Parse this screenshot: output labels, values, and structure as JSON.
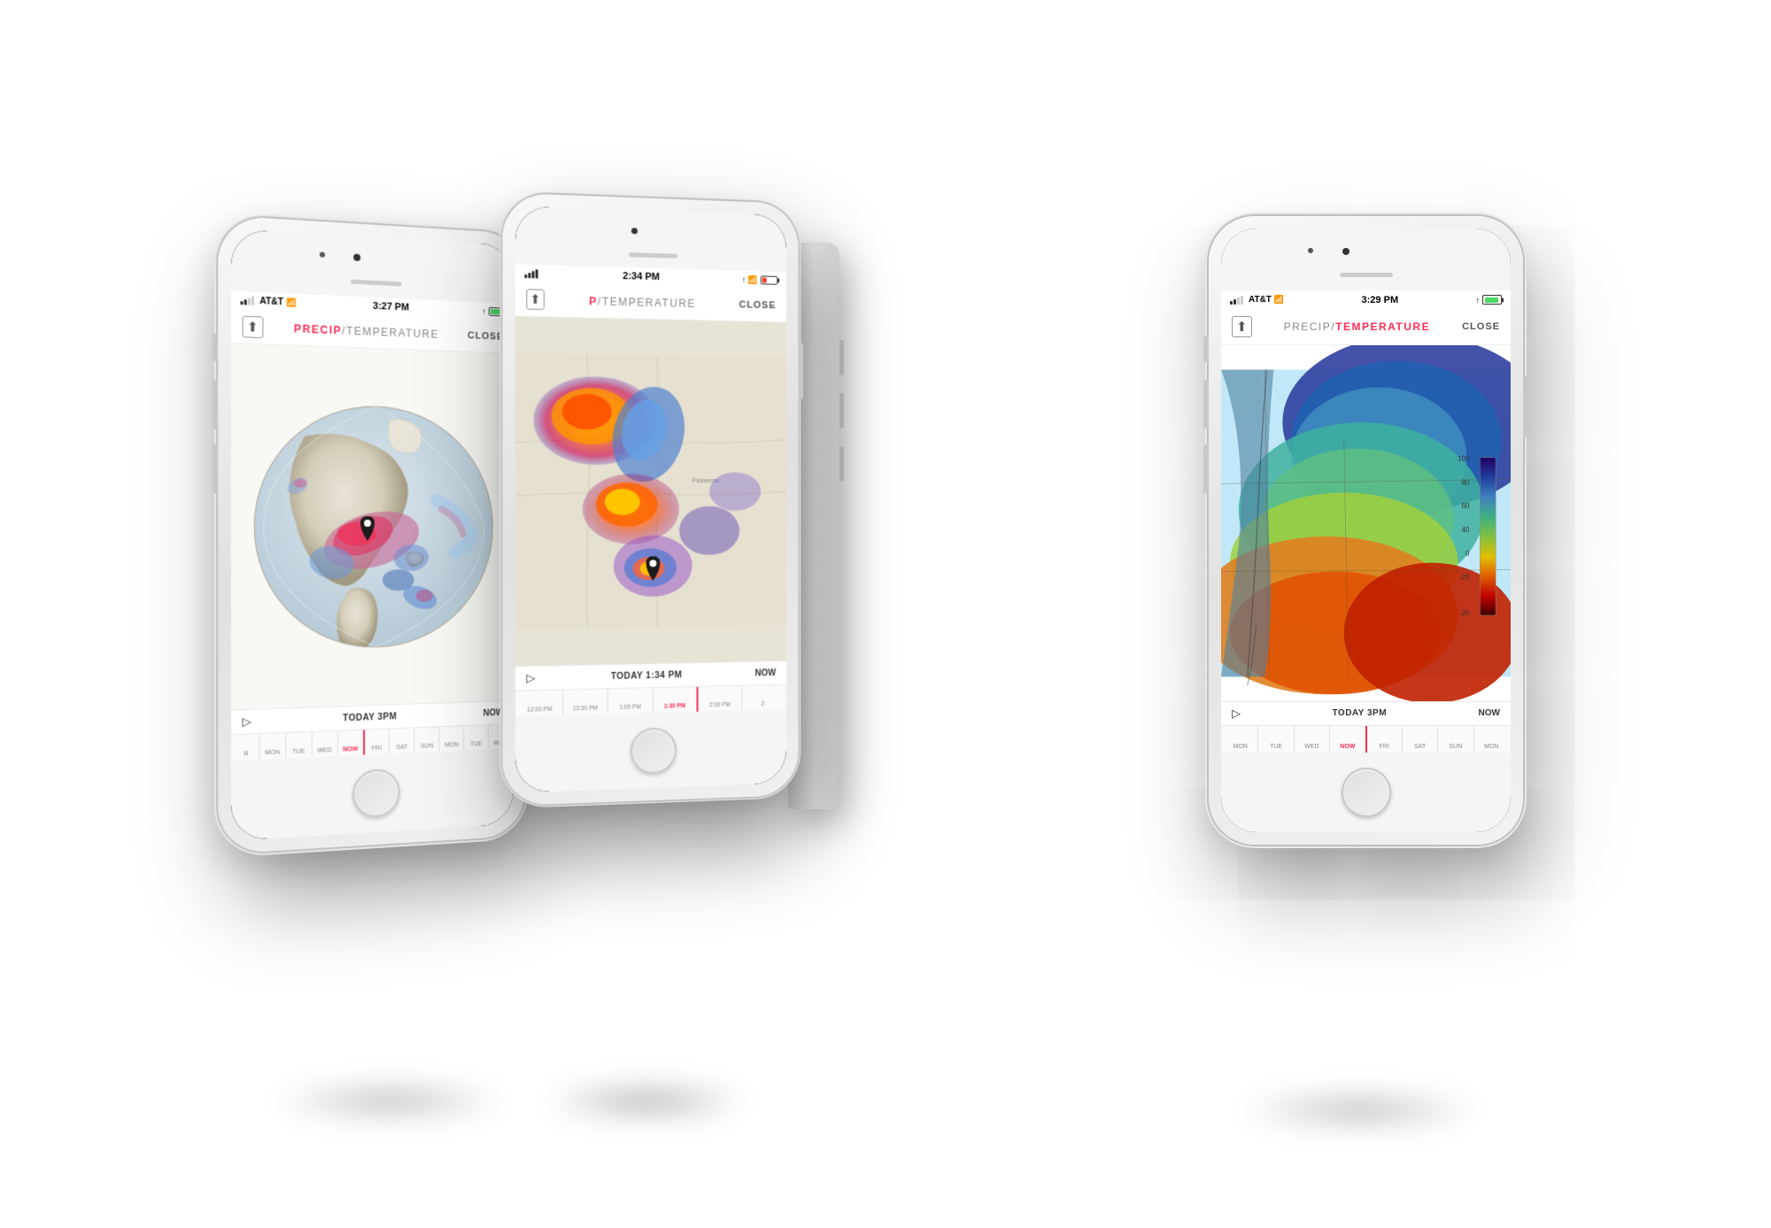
{
  "phones": {
    "left": {
      "status": {
        "carrier": "AT&T",
        "time": "3:27 PM",
        "signal": "●●○○",
        "wifi": true,
        "gps": true,
        "battery": 75,
        "battery_charging": true
      },
      "header": {
        "precip_label": "PRECIP",
        "slash": " / ",
        "temp_label": "TEMPERATURE",
        "close_label": "CLOSE",
        "precip_active": true
      },
      "timeline": {
        "play_symbol": "▷",
        "time_label": "TODAY  3PM",
        "now_label": "NOW",
        "ticks": [
          "N",
          "MON",
          "TUE",
          "WED",
          "NOW",
          "FRI",
          "SAT",
          "SUN",
          "MON",
          "TUE",
          "WED"
        ]
      },
      "map_type": "globe"
    },
    "center": {
      "status": {
        "carrier": "",
        "time": "2:34 PM",
        "signal": "●●●●",
        "wifi": true,
        "gps": true,
        "battery": 30,
        "battery_charging": false
      },
      "header": {
        "precip_label": "P",
        "slash": " / ",
        "temp_label": "TEMPERATURE",
        "close_label": "CLOSE",
        "precip_active": true
      },
      "timeline": {
        "play_symbol": "▷",
        "time_label": "TODAY  1:34 PM",
        "now_label": "NOW",
        "ticks": [
          "12:00 PM",
          "12:30 PM",
          "1:00 PM",
          "1:30 PM",
          "2:00 PM",
          "2:"
        ]
      },
      "map_type": "regional"
    },
    "right": {
      "status": {
        "carrier": "AT&T",
        "time": "3:29 PM",
        "signal": "●●○○",
        "wifi": true,
        "gps": true,
        "battery": 90,
        "battery_charging": true,
        "battery_green": true
      },
      "header": {
        "precip_label": "PRECIP",
        "slash": " / ",
        "temp_label": "TEMPERATURE",
        "close_label": "CLOSE",
        "temp_active": true
      },
      "timeline": {
        "play_symbol": "▷",
        "time_label": "TODAY  3PM",
        "now_label": "NOW",
        "ticks": [
          "MON",
          "TUE",
          "WED",
          "NOW",
          "FRI",
          "SAT",
          "SUN",
          "MON"
        ]
      },
      "map_type": "temperature",
      "legend": {
        "values": [
          "100",
          "80",
          "60",
          "40",
          "0",
          "-20"
        ],
        "colors": [
          "#1a0a2e",
          "#2d1b6e",
          "#1a6b9a",
          "#2aaa6e",
          "#ffdd00",
          "#ff6600",
          "#cc0000"
        ]
      }
    }
  },
  "icons": {
    "share": "⬆",
    "play": "▷",
    "wifi": "WiFi",
    "gps": "↑"
  }
}
